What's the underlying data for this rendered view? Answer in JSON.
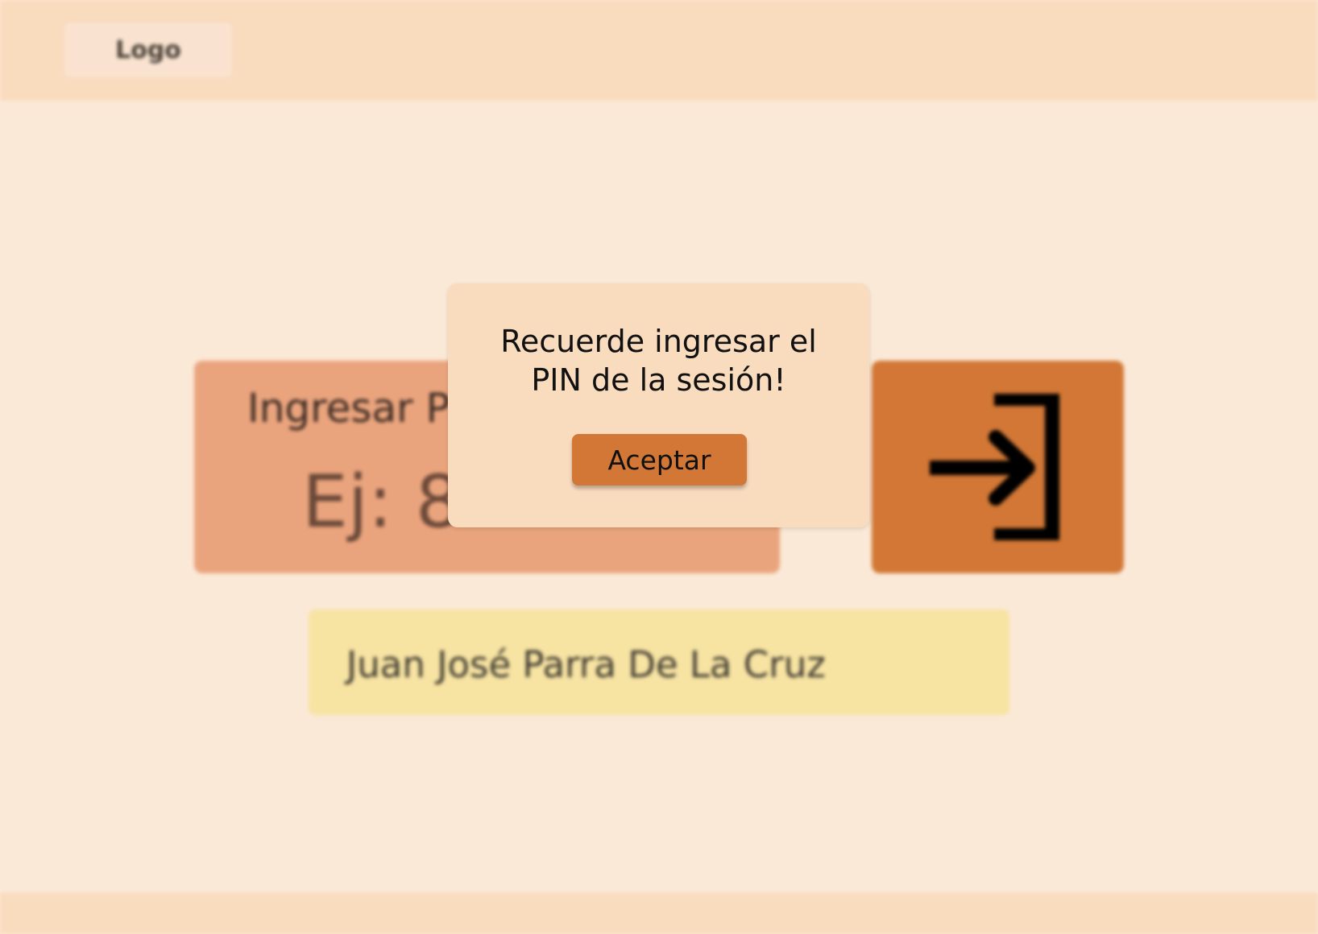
{
  "header": {
    "logo_label": "Logo"
  },
  "pin_form": {
    "label": "Ingresar PIN",
    "placeholder": "Ej: 8",
    "value": ""
  },
  "login_button": {
    "icon": "login-enter-icon"
  },
  "user": {
    "name": "Juan José Parra De La Cruz"
  },
  "modal": {
    "message_line1": "Recuerde ingresar el",
    "message_line2": "PIN de la sesión!",
    "accept_label": "Aceptar"
  },
  "colors": {
    "page_background": "#fbe9d7",
    "header_footer": "#f9dbbe",
    "pin_card": "#eaa47d",
    "accent": "#d27735",
    "name_card": "#f7e3a2",
    "modal_background": "#f9dbbe"
  }
}
